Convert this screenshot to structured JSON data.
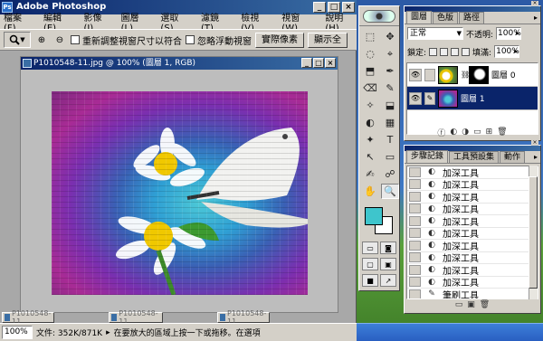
{
  "app": {
    "title": "Adobe Photoshop",
    "logo_text": "Ps"
  },
  "window_buttons": {
    "minimize": "_",
    "maximize": "□",
    "close": "×"
  },
  "menu": [
    "檔案(F)",
    "編輯(E)",
    "影像(I)",
    "圖層(L)",
    "選取(S)",
    "濾鏡(T)",
    "檢視(V)",
    "視窗(W)",
    "說明(H)"
  ],
  "options_bar": {
    "zoom_in_icon": "⊕",
    "zoom_out_icon": "⊖",
    "resize_windows_label": "重新調整視窗尺寸以符合",
    "ignore_palettes_label": "忽略浮動視窗",
    "actual_pixels_button": "實際像素",
    "fit_screen_button": "顯示全"
  },
  "document": {
    "title": "P1010548-11.jpg @ 100% (圖層 1, RGB)",
    "minimized": [
      "P1010548-11...",
      "P1010548-11...",
      "P1010548-11..."
    ]
  },
  "status": {
    "zoom": "100%",
    "doc_info": "文件: 352K/871K",
    "hint": "在要放大的區域上按一下或拖移。在選項"
  },
  "tool_icons": [
    "⬚",
    "✥",
    "◌",
    "⌖",
    "⬒",
    "✒",
    "⌫",
    "✎",
    "✧",
    "⬓",
    "◐",
    "▦",
    "✦",
    "T",
    "↖",
    "▭",
    "✍",
    "☍",
    "✋",
    "🔍"
  ],
  "layers_panel": {
    "tabs": [
      "圖層",
      "色版",
      "路徑"
    ],
    "blend_mode": "正常",
    "opacity_label": "不透明:",
    "opacity_value": "100%",
    "lock_label": "鎖定:",
    "fill_label": "填滿:",
    "fill_value": "100%",
    "layers": [
      {
        "name": "圖層 0",
        "selected": false
      },
      {
        "name": "圖層 1",
        "selected": true
      }
    ],
    "footer_icons": [
      "ⓕ",
      "◐",
      "◑",
      "▭",
      "⊞",
      "🗑"
    ]
  },
  "history_panel": {
    "tabs": [
      "步驟記錄",
      "工具預設集",
      "動作"
    ],
    "items": [
      "加深工具",
      "加深工具",
      "加深工具",
      "加深工具",
      "加深工具",
      "加深工具",
      "加深工具",
      "加深工具",
      "加深工具",
      "加深工具",
      "筆刷工具"
    ],
    "footer_icons": [
      "▭",
      "▣",
      "🗑"
    ]
  },
  "colors": {
    "foreground": "#3ec5cc",
    "background": "#ffffff",
    "accent": "#0a246a"
  }
}
